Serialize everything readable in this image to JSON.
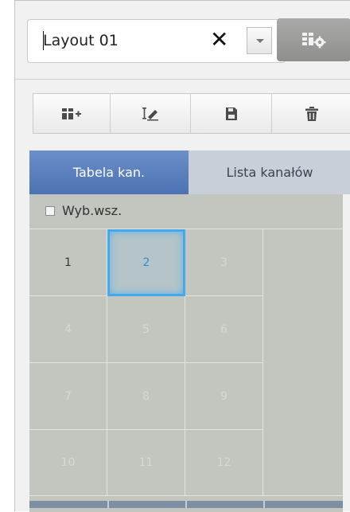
{
  "layout_selector": {
    "value": "Layout 01",
    "clear_icon": "close-icon",
    "dropdown_icon": "chevron-down-icon"
  },
  "settings_button": {
    "icon": "layout-settings-icon"
  },
  "toolbar": {
    "buttons": [
      {
        "name": "add-layout",
        "icon": "add-layout-icon"
      },
      {
        "name": "rename-layout",
        "icon": "rename-icon"
      },
      {
        "name": "save-layout",
        "icon": "save-icon"
      },
      {
        "name": "delete-layout",
        "icon": "trash-icon"
      }
    ]
  },
  "tabs": {
    "channel_table": "Tabela kan.",
    "channel_list": "Lista kanałów"
  },
  "select_all_label": "Wyb.wsz.",
  "channels": {
    "c1": "1",
    "c2": "2",
    "c3": "3",
    "c4": "4",
    "c5": "5",
    "c6": "6",
    "c7": "7",
    "c8": "8",
    "c9": "9",
    "c10": "10",
    "c11": "11",
    "c12": "12"
  },
  "selected_channel": "2",
  "colors": {
    "active_tab": "#5a7fbe",
    "inactive_tab": "#c9cfd8",
    "grid_bg": "#c2c6bf",
    "selection": "#41a9ec"
  }
}
